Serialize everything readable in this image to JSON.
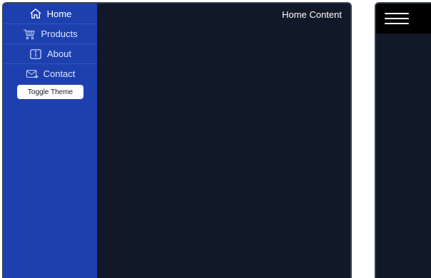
{
  "sidebar": {
    "items": [
      {
        "label": "Home",
        "icon": "home-icon",
        "active": true
      },
      {
        "label": "Products",
        "icon": "cart-icon",
        "active": false
      },
      {
        "label": "About",
        "icon": "info-icon",
        "active": false
      },
      {
        "label": "Contact",
        "icon": "mail-icon",
        "active": false
      }
    ],
    "theme_button_label": "Toggle Theme"
  },
  "main": {
    "title": "Home Content"
  },
  "mobile": {
    "menu_icon": "hamburger-menu-icon"
  },
  "colors": {
    "sidebar_bg": "#1e40af",
    "content_bg": "#111827",
    "mobile_header_bg": "#000000",
    "text": "#ffffff"
  }
}
